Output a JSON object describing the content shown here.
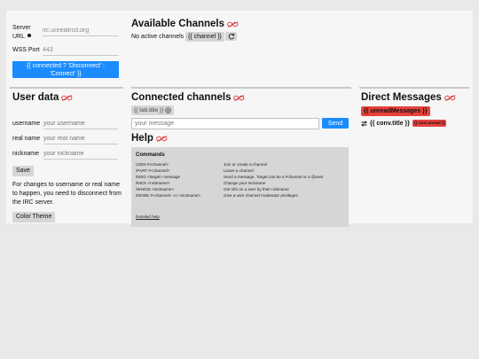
{
  "server": {
    "url_label": "Server URL",
    "url_value": "irc.unrealircd.org",
    "port_label": "WSS Port",
    "port_value": "443",
    "connect_button": "{{ connected ? 'Disconnect' : 'Connect' }}"
  },
  "channels": {
    "title": "Available Channels",
    "empty_text": "No active channels",
    "channel_chip": "{{ channel }}"
  },
  "user": {
    "title": "User data",
    "username_label": "username",
    "username_placeholder": "your username",
    "realname_label": "real name",
    "realname_placeholder": "your real name",
    "nickname_label": "nickname",
    "nickname_placeholder": "your nickname",
    "save_button": "Save",
    "note": "For changes to username or real name to happen, you need to disconnect from the IRC server.",
    "theme_button": "Color Theme"
  },
  "connected": {
    "title": "Connected channels",
    "tab_chip": "{{ tab.title }}",
    "message_placeholder": "your message",
    "send_button": "Send"
  },
  "help": {
    "title": "Help",
    "commands_title": "Commands",
    "commands": [
      {
        "cmd": "/JOIN #<channel>",
        "desc": "Join or create a channel"
      },
      {
        "cmd": "/PART #<channel>",
        "desc": "Leave a channel"
      },
      {
        "cmd": "/MSG <target> message",
        "desc": "Send a message. Target can be a #channel or a @user"
      },
      {
        "cmd": "/NICK <nickname>",
        "desc": "Change your nickname"
      },
      {
        "cmd": "/WHOIS <nickname>",
        "desc": "Get info on a user by their nickname"
      },
      {
        "cmd": "/MODE #<channel> +o <nickname>",
        "desc": "Give a user channel moderator privileges"
      }
    ],
    "detailed_link": "Detailed help"
  },
  "dms": {
    "title": "Direct Messages",
    "unread_badge": "{{ unreadMessages }}",
    "conv_title": "{{ conv.title }}",
    "conv_unread": "{{ conv.unread }}"
  },
  "colors": {
    "accent": "#1a8cff",
    "unread": "#e8413c",
    "eye_icon": "#e03c3c"
  }
}
